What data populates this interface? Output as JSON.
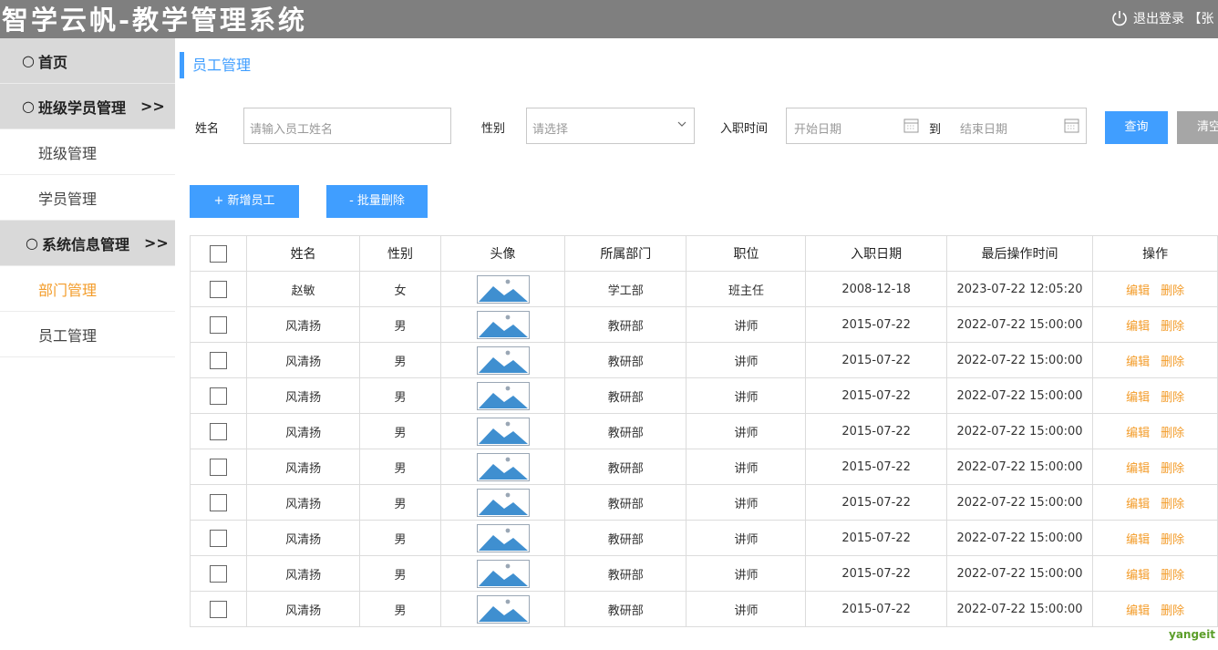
{
  "header": {
    "title": "智学云帆-教学管理系统",
    "logout": "退出登录 【张"
  },
  "sidebar": {
    "items": [
      {
        "label": "首页"
      },
      {
        "label": "班级学员管理",
        "arrow": ">>"
      },
      {
        "label": "班级管理"
      },
      {
        "label": "学员管理"
      },
      {
        "label": "系统信息管理",
        "arrow": ">>"
      },
      {
        "label": "部门管理"
      },
      {
        "label": "员工管理"
      }
    ]
  },
  "page": {
    "title": "员工管理"
  },
  "filter": {
    "name_label": "姓名",
    "name_placeholder": "请输入员工姓名",
    "gender_label": "性别",
    "gender_placeholder": "请选择",
    "date_label": "入职时间",
    "start_placeholder": "开始日期",
    "to": "到",
    "end_placeholder": "结束日期",
    "query_btn": "查询",
    "clear_btn": "清空"
  },
  "actions": {
    "add": "+ 新增员工",
    "batch_delete": "- 批量删除"
  },
  "table": {
    "headers": [
      "姓名",
      "性别",
      "头像",
      "所属部门",
      "职位",
      "入职日期",
      "最后操作时间",
      "操作"
    ],
    "edit_label": "编辑",
    "delete_label": "删除",
    "rows": [
      {
        "name": "赵敏",
        "gender": "女",
        "dept": "学工部",
        "job": "班主任",
        "entry": "2008-12-18",
        "updated": "2023-07-22 12:05:20"
      },
      {
        "name": "风清扬",
        "gender": "男",
        "dept": "教研部",
        "job": "讲师",
        "entry": "2015-07-22",
        "updated": "2022-07-22 15:00:00"
      },
      {
        "name": "风清扬",
        "gender": "男",
        "dept": "教研部",
        "job": "讲师",
        "entry": "2015-07-22",
        "updated": "2022-07-22 15:00:00"
      },
      {
        "name": "风清扬",
        "gender": "男",
        "dept": "教研部",
        "job": "讲师",
        "entry": "2015-07-22",
        "updated": "2022-07-22 15:00:00"
      },
      {
        "name": "风清扬",
        "gender": "男",
        "dept": "教研部",
        "job": "讲师",
        "entry": "2015-07-22",
        "updated": "2022-07-22 15:00:00"
      },
      {
        "name": "风清扬",
        "gender": "男",
        "dept": "教研部",
        "job": "讲师",
        "entry": "2015-07-22",
        "updated": "2022-07-22 15:00:00"
      },
      {
        "name": "风清扬",
        "gender": "男",
        "dept": "教研部",
        "job": "讲师",
        "entry": "2015-07-22",
        "updated": "2022-07-22 15:00:00"
      },
      {
        "name": "风清扬",
        "gender": "男",
        "dept": "教研部",
        "job": "讲师",
        "entry": "2015-07-22",
        "updated": "2022-07-22 15:00:00"
      },
      {
        "name": "风清扬",
        "gender": "男",
        "dept": "教研部",
        "job": "讲师",
        "entry": "2015-07-22",
        "updated": "2022-07-22 15:00:00"
      },
      {
        "name": "风清扬",
        "gender": "男",
        "dept": "教研部",
        "job": "讲师",
        "entry": "2015-07-22",
        "updated": "2022-07-22 15:00:00"
      }
    ]
  },
  "footer": {
    "brand": "yangeit"
  },
  "colors": {
    "accent": "#409eff",
    "link": "#f39c2a",
    "header_bg": "#7f7f7f",
    "sidebar_group_bg": "#d9d9d9"
  }
}
